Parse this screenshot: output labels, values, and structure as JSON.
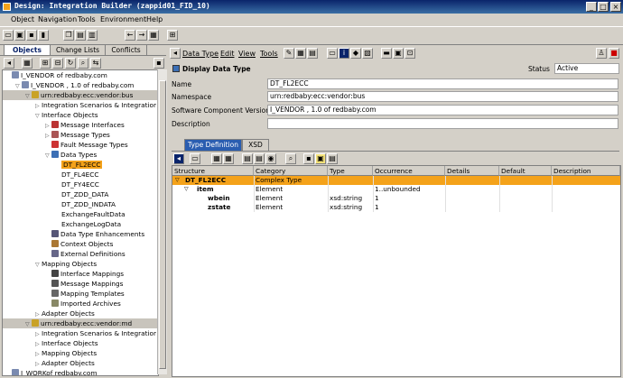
{
  "window": {
    "title": "Design: Integration Builder (zappid01_FID_10)"
  },
  "menu": [
    "Object",
    "Navigation",
    "Tools",
    "Environment",
    "Help"
  ],
  "left_tabs": [
    "Objects",
    "Change Lists",
    "Conflicts"
  ],
  "tree": [
    {
      "text": "I_VENDOR of redbaby.com",
      "level": 0,
      "twisty": "",
      "icon": "swcv-icon",
      "hl": false,
      "selected": false
    },
    {
      "text": "I_VENDOR , 1.0 of redbaby.com",
      "level": 1,
      "twisty": "▽",
      "icon": "swcv-icon",
      "hl": false,
      "selected": false
    },
    {
      "text": "urn:redbaby:ecc:vendor:bus",
      "level": 2,
      "twisty": "▽",
      "icon": "namespace-icon",
      "hl": true,
      "selected": false
    },
    {
      "text": "Integration Scenarios & Integratior",
      "level": 3,
      "twisty": "▷",
      "icon": "",
      "hl": false,
      "selected": false
    },
    {
      "text": "Interface Objects",
      "level": 3,
      "twisty": "▽",
      "icon": "",
      "hl": false,
      "selected": false
    },
    {
      "text": "Message Interfaces",
      "level": 4,
      "twisty": "▷",
      "icon": "message-interface-icon",
      "hl": false,
      "selected": false
    },
    {
      "text": "Message Types",
      "level": 4,
      "twisty": "▷",
      "icon": "message-type-icon",
      "hl": false,
      "selected": false
    },
    {
      "text": "Fault Message Types",
      "level": 4,
      "twisty": "",
      "icon": "fault-message-icon",
      "hl": false,
      "selected": false
    },
    {
      "text": "Data Types",
      "level": 4,
      "twisty": "▽",
      "icon": "data-type-icon",
      "hl": false,
      "selected": false
    },
    {
      "text": "DT_FL2ECC",
      "level": 5,
      "twisty": "",
      "icon": "",
      "hl": false,
      "selected": true
    },
    {
      "text": "DT_FL4ECC",
      "level": 5,
      "twisty": "",
      "icon": "",
      "hl": false,
      "selected": false
    },
    {
      "text": "DT_FY4ECC",
      "level": 5,
      "twisty": "",
      "icon": "",
      "hl": false,
      "selected": false
    },
    {
      "text": "DT_ZDD_DATA",
      "level": 5,
      "twisty": "",
      "icon": "",
      "hl": false,
      "selected": false
    },
    {
      "text": "DT_ZDD_INDATA",
      "level": 5,
      "twisty": "",
      "icon": "",
      "hl": false,
      "selected": false
    },
    {
      "text": "ExchangeFaultData",
      "level": 5,
      "twisty": "",
      "icon": "",
      "hl": false,
      "selected": false
    },
    {
      "text": "ExchangeLogData",
      "level": 5,
      "twisty": "",
      "icon": "",
      "hl": false,
      "selected": false
    },
    {
      "text": "Data Type Enhancements",
      "level": 4,
      "twisty": "",
      "icon": "dt-enhancement-icon",
      "hl": false,
      "selected": false
    },
    {
      "text": "Context Objects",
      "level": 4,
      "twisty": "",
      "icon": "context-object-icon",
      "hl": false,
      "selected": false
    },
    {
      "text": "External Definitions",
      "level": 4,
      "twisty": "",
      "icon": "external-def-icon",
      "hl": false,
      "selected": false
    },
    {
      "text": "Mapping Objects",
      "level": 3,
      "twisty": "▽",
      "icon": "",
      "hl": false,
      "selected": false
    },
    {
      "text": "Interface Mappings",
      "level": 4,
      "twisty": "",
      "icon": "interface-mapping-icon",
      "hl": false,
      "selected": false
    },
    {
      "text": "Message Mappings",
      "level": 4,
      "twisty": "",
      "icon": "message-mapping-icon",
      "hl": false,
      "selected": false
    },
    {
      "text": "Mapping Templates",
      "level": 4,
      "twisty": "",
      "icon": "mapping-template-icon",
      "hl": false,
      "selected": false
    },
    {
      "text": "Imported Archives",
      "level": 4,
      "twisty": "",
      "icon": "archive-icon",
      "hl": false,
      "selected": false
    },
    {
      "text": "Adapter Objects",
      "level": 3,
      "twisty": "▷",
      "icon": "",
      "hl": false,
      "selected": false
    },
    {
      "text": "urn:redbaby:ecc:vendor:md",
      "level": 2,
      "twisty": "▽",
      "icon": "namespace-icon",
      "hl": true,
      "selected": false
    },
    {
      "text": "Integration Scenarios & Integratior",
      "level": 3,
      "twisty": "▷",
      "icon": "",
      "hl": false,
      "selected": false
    },
    {
      "text": "Interface Objects",
      "level": 3,
      "twisty": "▷",
      "icon": "",
      "hl": false,
      "selected": false
    },
    {
      "text": "Mapping Objects",
      "level": 3,
      "twisty": "▷",
      "icon": "",
      "hl": false,
      "selected": false
    },
    {
      "text": "Adapter Objects",
      "level": 3,
      "twisty": "▷",
      "icon": "",
      "hl": false,
      "selected": false
    },
    {
      "text": "I_WORKof redbaby.com",
      "level": 0,
      "twisty": "",
      "icon": "swcv-icon",
      "hl": false,
      "selected": false
    }
  ],
  "right_menu": [
    "Data Type",
    "Edit",
    "View",
    "Tools"
  ],
  "header": {
    "title": "Display Data Type",
    "status_label": "Status",
    "status_value": "Active"
  },
  "fields": [
    {
      "label": "Name",
      "value": "DT_FL2ECC"
    },
    {
      "label": "Namespace",
      "value": "urn:redbaby:ecc:vendor:bus"
    },
    {
      "label": "Software Component Version",
      "value": "I_VENDOR , 1.0 of redbaby.com"
    },
    {
      "label": "Description",
      "value": ""
    }
  ],
  "detail_tabs": [
    "Type Definition",
    "XSD"
  ],
  "grid": {
    "columns": [
      "Structure",
      "Category",
      "Type",
      "Occurrence",
      "Details",
      "Default",
      "Description"
    ],
    "rows": [
      {
        "structure": "DT_FL2ECC",
        "twisty": "▽",
        "category": "Complex Type",
        "type": "",
        "occurrence": ""
      },
      {
        "structure": "item",
        "twisty": "▽",
        "category": "Element",
        "type": "",
        "occurrence": "1..unbounded"
      },
      {
        "structure": "wbein",
        "twisty": "",
        "category": "Element",
        "type": "xsd:string",
        "occurrence": "1"
      },
      {
        "structure": "zstate",
        "twisty": "",
        "category": "Element",
        "type": "xsd:string",
        "occurrence": "1"
      }
    ]
  },
  "colors": {
    "selection": "#f4a21a",
    "title_bar": "#0a246a",
    "tab_active": "#2a5db0"
  }
}
